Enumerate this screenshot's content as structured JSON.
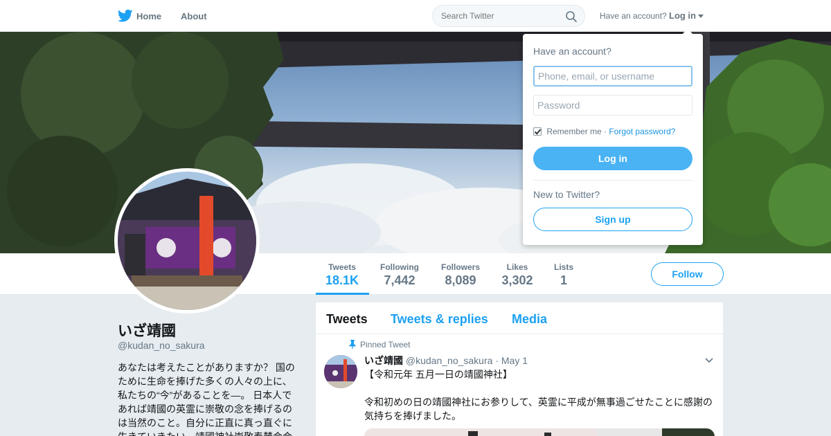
{
  "topbar": {
    "logo_icon": "twitter-bird-icon",
    "nav_home": "Home",
    "nav_about": "About",
    "search_placeholder": "Search Twitter",
    "have_account": "Have an account?",
    "login_label": "Log in",
    "brand_color": "#1da1f2"
  },
  "stats": [
    {
      "label": "Tweets",
      "value": "18.1K"
    },
    {
      "label": "Following",
      "value": "7,442"
    },
    {
      "label": "Followers",
      "value": "8,089"
    },
    {
      "label": "Likes",
      "value": "3,302"
    },
    {
      "label": "Lists",
      "value": "1"
    }
  ],
  "follow_label": "Follow",
  "profile": {
    "name": "いざ靖國",
    "handle": "@kudan_no_sakura",
    "bio": "あなたは考えたことがありますか？ 国のために生命を捧げた多くの人々の上に、私たちの“今”があることを—。 日本人であれば靖國の英霊に崇敬の念を捧げるのは当然のこと。自分に正直に真っ直ぐに生きていきたい。靖國神社崇敬奉賛会会"
  },
  "timeline": {
    "tabs": [
      "Tweets",
      "Tweets & replies",
      "Media"
    ],
    "pinned_label": "Pinned Tweet",
    "tweet": {
      "name": "いざ靖國",
      "handle": "@kudan_no_sakura",
      "dot": "·",
      "date": "May 1",
      "line1": "【令和元年 五月一日の靖國神社】",
      "line2": "令和初めの日の靖國神社にお参りして、英霊に平成が無事過ごせたことに感謝の気持ちを捧げました。"
    }
  },
  "login_dropdown": {
    "title": "Have an account?",
    "username_placeholder": "Phone, email, or username",
    "password_placeholder": "Password",
    "remember_label": "Remember me",
    "separator": "·",
    "forgot_label": "Forgot password?",
    "login_button": "Log in",
    "new_label": "New to Twitter?",
    "signup_button": "Sign up"
  }
}
